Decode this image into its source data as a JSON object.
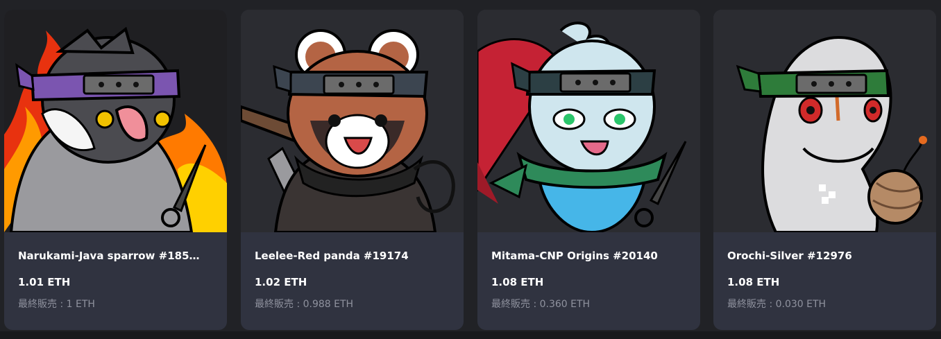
{
  "cards": [
    {
      "image_name": "java-sparrow-ninja",
      "title": "Narukami-Java sparrow #185…",
      "price": "1.01 ETH",
      "last_sale": "最終販売 : 1 ETH",
      "bg_color": "#ff8a00"
    },
    {
      "image_name": "red-panda-ninja",
      "title": "Leelee-Red panda #19174",
      "price": "1.02 ETH",
      "last_sale": "最終販売 : 0.988 ETH",
      "bg_color": "#2b2c31"
    },
    {
      "image_name": "ghost-ninja",
      "title": "Mitama-CNP Origins #20140",
      "price": "1.08 ETH",
      "last_sale": "最終販売 : 0.360 ETH",
      "bg_color": "#2b2c31"
    },
    {
      "image_name": "silver-snake-ninja",
      "title": "Orochi-Silver #12976",
      "price": "1.08 ETH",
      "last_sale": "最終販売 : 0.030 ETH",
      "bg_color": "#2b2c31"
    }
  ]
}
